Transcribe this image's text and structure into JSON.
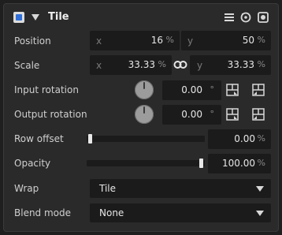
{
  "header": {
    "title": "Tile",
    "enabled": true,
    "icons": [
      "menu-icon",
      "reset-icon",
      "camera-icon"
    ]
  },
  "position": {
    "label": "Position",
    "x_axis": "x",
    "x_value": "16",
    "x_unit": "%",
    "y_axis": "y",
    "y_value": "50",
    "y_unit": "%"
  },
  "scale": {
    "label": "Scale",
    "x_axis": "x",
    "x_value": "33.33",
    "x_unit": "%",
    "link_icon": "link-icon",
    "y_axis": "y",
    "y_value": "33.33",
    "y_unit": "%"
  },
  "input_rotation": {
    "label": "Input rotation",
    "value": "0.00",
    "unit": "°"
  },
  "output_rotation": {
    "label": "Output rotation",
    "value": "0.00",
    "unit": "°"
  },
  "row_offset": {
    "label": "Row offset",
    "value": "0.00",
    "unit": "%",
    "fraction": 0.0
  },
  "opacity": {
    "label": "Opacity",
    "value": "100.00",
    "unit": "%",
    "fraction": 1.0
  },
  "wrap": {
    "label": "Wrap",
    "selected": "Tile"
  },
  "blend_mode": {
    "label": "Blend mode",
    "selected": "None"
  },
  "colors": {
    "accent": "#2f6fd6",
    "panel": "#2a2a2a",
    "field": "#1b1b1b"
  }
}
